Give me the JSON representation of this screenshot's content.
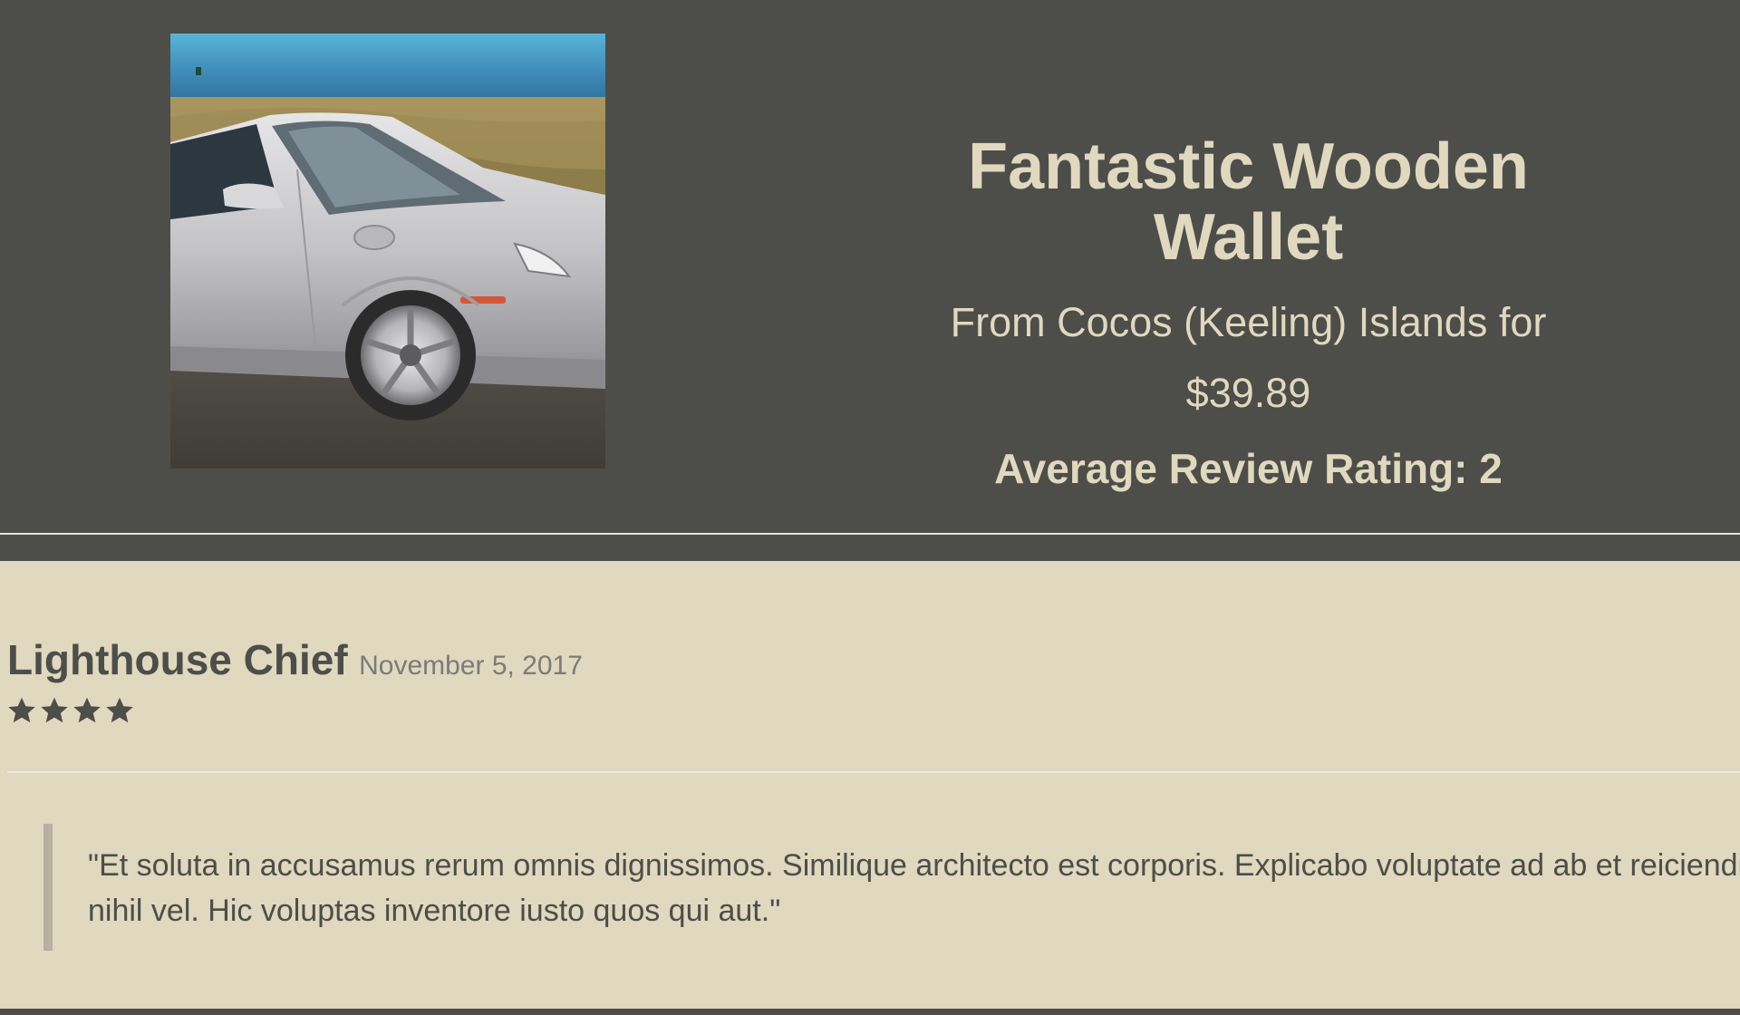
{
  "product": {
    "title": "Fantastic Wooden Wallet",
    "origin_line": "From Cocos (Keeling) Islands for",
    "price": "$39.89",
    "rating_text": "Average Review Rating: 2",
    "image_name": "silver sports car photo"
  },
  "review": {
    "author": "Lighthouse Chief",
    "date": "November 5, 2017",
    "stars": 4,
    "text": "\"Et soluta in accusamus rerum omnis dignissimos. Similique architecto est corporis. Explicabo voluptate ad ab et reiciendis nihil vel. Hic voluptas inventore iusto quos qui aut.\""
  },
  "colors": {
    "header_bg": "#4d4e49",
    "header_text": "#e0d8bf",
    "review_bg": "#e0d8bf",
    "review_text": "#4d4e49",
    "date_text": "#7b7c77",
    "quote_border": "#b6b09e"
  },
  "icons": {
    "star": "star-icon"
  }
}
